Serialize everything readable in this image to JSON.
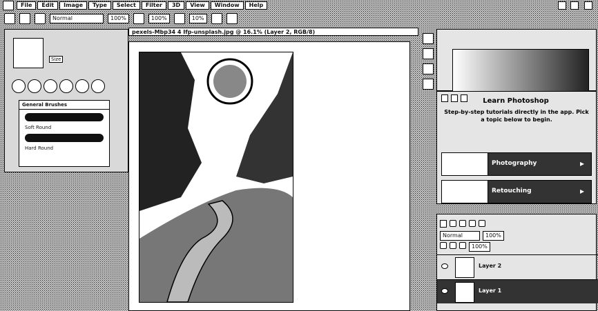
{
  "menubar": {
    "items": [
      "File",
      "Edit",
      "Image",
      "Type",
      "Select",
      "Filter",
      "3D",
      "View",
      "Window",
      "Help"
    ]
  },
  "options": {
    "mode_value": "Normal",
    "opacity_label": "100%",
    "flow_label": "100%",
    "smoothing_label": "10%"
  },
  "document": {
    "tab_title": "pexels-Mbp34 4 Ifp-unsplash.jpg @ 16.1% (Layer 2, RGB/8)"
  },
  "brush_panel": {
    "size_label": "Size",
    "folder_label": "General Brushes",
    "brushes": [
      "Soft Round",
      "Hard Round"
    ]
  },
  "learn": {
    "title": "Learn Photoshop",
    "subtitle": "Step-by-step tutorials directly in the app. Pick a topic below to begin.",
    "tutorials": [
      "Photography",
      "Retouching"
    ]
  },
  "layers": {
    "blend_mode": "Normal",
    "opacity": "100%",
    "fill": "100%",
    "items": [
      "Layer 2",
      "Layer 1"
    ]
  }
}
